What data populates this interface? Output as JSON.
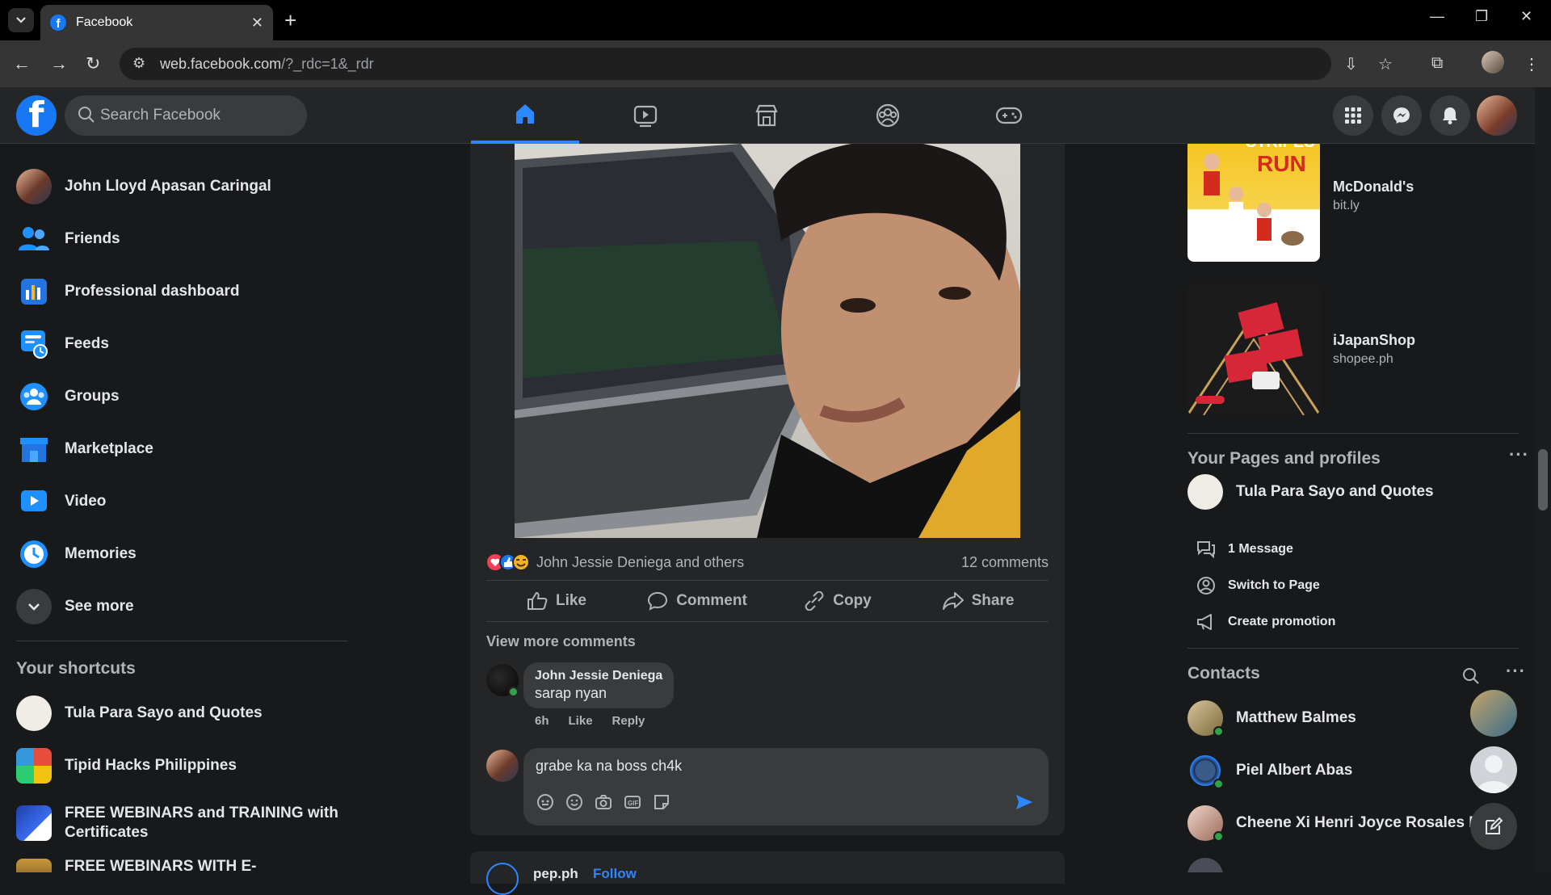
{
  "browser": {
    "tab_title": "Facebook",
    "url_host": "web.facebook.com",
    "url_path": "/?_rdc=1&_rdr"
  },
  "header": {
    "search_placeholder": "Search Facebook"
  },
  "left_nav": {
    "items": [
      {
        "label": "John Lloyd Apasan Caringal",
        "icon": "user-avatar"
      },
      {
        "label": "Friends",
        "icon": "friends-icon"
      },
      {
        "label": "Professional dashboard",
        "icon": "dashboard-icon"
      },
      {
        "label": "Feeds",
        "icon": "feeds-icon"
      },
      {
        "label": "Groups",
        "icon": "groups-icon"
      },
      {
        "label": "Marketplace",
        "icon": "marketplace-icon"
      },
      {
        "label": "Video",
        "icon": "video-icon"
      },
      {
        "label": "Memories",
        "icon": "memories-icon"
      },
      {
        "label": "See more",
        "icon": "chevron-down-icon"
      }
    ],
    "shortcuts_title": "Your shortcuts",
    "shortcuts": [
      {
        "label": "Tula Para Sayo and Quotes"
      },
      {
        "label": "Tipid Hacks Philippines"
      },
      {
        "label": "FREE WEBINARS and TRAINING with Certificates"
      },
      {
        "label": "FREE WEBINARS WITH E-CERTIFICATES"
      }
    ]
  },
  "post": {
    "reactors": "John Jessie Deniega and others",
    "comment_count": "12 comments",
    "actions": [
      "Like",
      "Comment",
      "Copy",
      "Share"
    ],
    "view_more": "View more comments",
    "comment": {
      "author": "John Jessie Deniega",
      "text": "sarap nyan",
      "time": "6h",
      "like": "Like",
      "reply": "Reply"
    },
    "draft": "grabe ka na boss ch4k"
  },
  "next_post": {
    "author": "pep.ph",
    "follow": "Follow"
  },
  "right": {
    "ads": [
      {
        "title": "McDonald's",
        "site": "bit.ly"
      },
      {
        "title": "iJapanShop",
        "site": "shopee.ph"
      }
    ],
    "pages_title": "Your Pages and profiles",
    "page_name": "Tula Para Sayo and Quotes",
    "page_actions": [
      "1 Message",
      "Switch to Page",
      "Create promotion"
    ],
    "contacts_title": "Contacts",
    "contacts": [
      {
        "name": "Matthew Balmes",
        "online": true
      },
      {
        "name": "Piel Albert Abas",
        "online": true
      },
      {
        "name": "Cheene Xi Henri Joyce Rosales Ma",
        "online": true
      }
    ]
  },
  "colors": {
    "accent": "#2d88ff",
    "surface": "#242526",
    "background": "#18191a",
    "online": "#31a24c"
  }
}
